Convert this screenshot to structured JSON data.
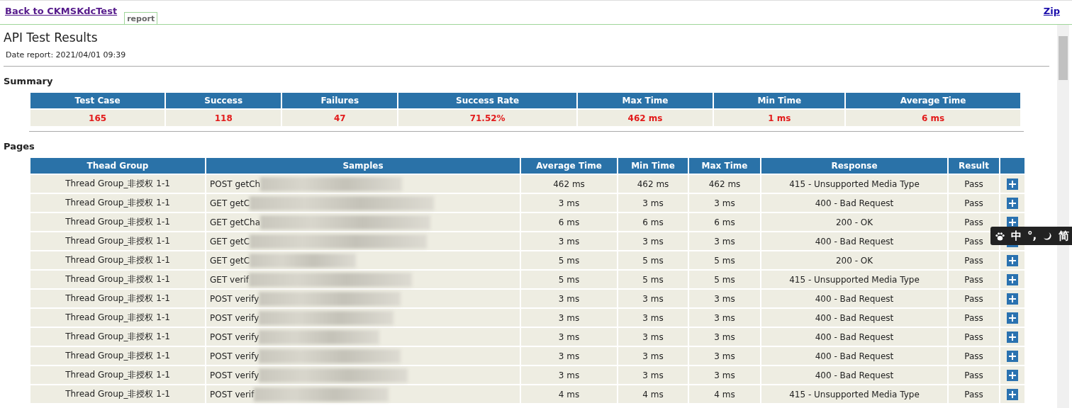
{
  "nav": {
    "back_link": "Back to CKMSKdcTest",
    "tab": {
      "label": "report",
      "selected": true
    },
    "zip_link": "Zip"
  },
  "title": "API Test Results",
  "date_report": "Date report: 2021/04/01 09:39",
  "summary": {
    "heading": "Summary",
    "columns": [
      "Test Case",
      "Success",
      "Failures",
      "Success Rate",
      "Max Time",
      "Min Time",
      "Average Time"
    ],
    "values": [
      "165",
      "118",
      "47",
      "71.52%",
      "462 ms",
      "1 ms",
      "6 ms"
    ]
  },
  "pages": {
    "heading": "Pages",
    "columns": [
      "Thead Group",
      "Samples",
      "Average Time",
      "Min Time",
      "Max Time",
      "Response",
      "Result"
    ],
    "rows": [
      {
        "group": "Thread Group_非授权 1-1",
        "sample": "POST getCh",
        "redacted": true,
        "avg": "462 ms",
        "min": "462 ms",
        "max": "462 ms",
        "response": "415 - Unsupported Media Type",
        "result": "Pass",
        "expanded": false
      },
      {
        "group": "Thread Group_非授权 1-1",
        "sample": "GET getC",
        "redacted": true,
        "avg": "3 ms",
        "min": "3 ms",
        "max": "3 ms",
        "response": "400 - Bad Request",
        "result": "Pass",
        "expanded": false
      },
      {
        "group": "Thread Group_非授权 1-1",
        "sample": "GET getCha",
        "redacted": true,
        "avg": "6 ms",
        "min": "6 ms",
        "max": "6 ms",
        "response": "200 - OK",
        "result": "Pass",
        "expanded": false
      },
      {
        "group": "Thread Group_非授权 1-1",
        "sample": "GET getC",
        "redacted": true,
        "avg": "3 ms",
        "min": "3 ms",
        "max": "3 ms",
        "response": "400 - Bad Request",
        "result": "Pass",
        "expanded": false
      },
      {
        "group": "Thread Group_非授权 1-1",
        "sample": "GET getC",
        "redacted": true,
        "avg": "5 ms",
        "min": "5 ms",
        "max": "5 ms",
        "response": "200 - OK",
        "result": "Pass",
        "expanded": false
      },
      {
        "group": "Thread Group_非授权 1-1",
        "sample": "GET verif",
        "redacted": true,
        "avg": "5 ms",
        "min": "5 ms",
        "max": "5 ms",
        "response": "415 - Unsupported Media Type",
        "result": "Pass",
        "expanded": false
      },
      {
        "group": "Thread Group_非授权 1-1",
        "sample": "POST verify",
        "redacted": true,
        "avg": "3 ms",
        "min": "3 ms",
        "max": "3 ms",
        "response": "400 - Bad Request",
        "result": "Pass",
        "expanded": false
      },
      {
        "group": "Thread Group_非授权 1-1",
        "sample": "POST verify",
        "redacted": true,
        "avg": "3 ms",
        "min": "3 ms",
        "max": "3 ms",
        "response": "400 - Bad Request",
        "result": "Pass",
        "expanded": false
      },
      {
        "group": "Thread Group_非授权 1-1",
        "sample": "POST verify",
        "redacted": true,
        "avg": "3 ms",
        "min": "3 ms",
        "max": "3 ms",
        "response": "400 - Bad Request",
        "result": "Pass",
        "expanded": false
      },
      {
        "group": "Thread Group_非授权 1-1",
        "sample": "POST verify",
        "redacted": true,
        "avg": "3 ms",
        "min": "3 ms",
        "max": "3 ms",
        "response": "400 - Bad Request",
        "result": "Pass",
        "expanded": false
      },
      {
        "group": "Thread Group_非授权 1-1",
        "sample": "POST verify",
        "redacted": true,
        "avg": "3 ms",
        "min": "3 ms",
        "max": "3 ms",
        "response": "400 - Bad Request",
        "result": "Pass",
        "expanded": false
      },
      {
        "group": "Thread Group_非授权 1-1",
        "sample": "POST verif",
        "redacted": true,
        "avg": "4 ms",
        "min": "4 ms",
        "max": "4 ms",
        "response": "415 - Unsupported Media Type",
        "result": "Pass",
        "expanded": false
      }
    ]
  },
  "ime_toolbar": {
    "mode": "中",
    "punctuation": "°,",
    "script": "简"
  }
}
